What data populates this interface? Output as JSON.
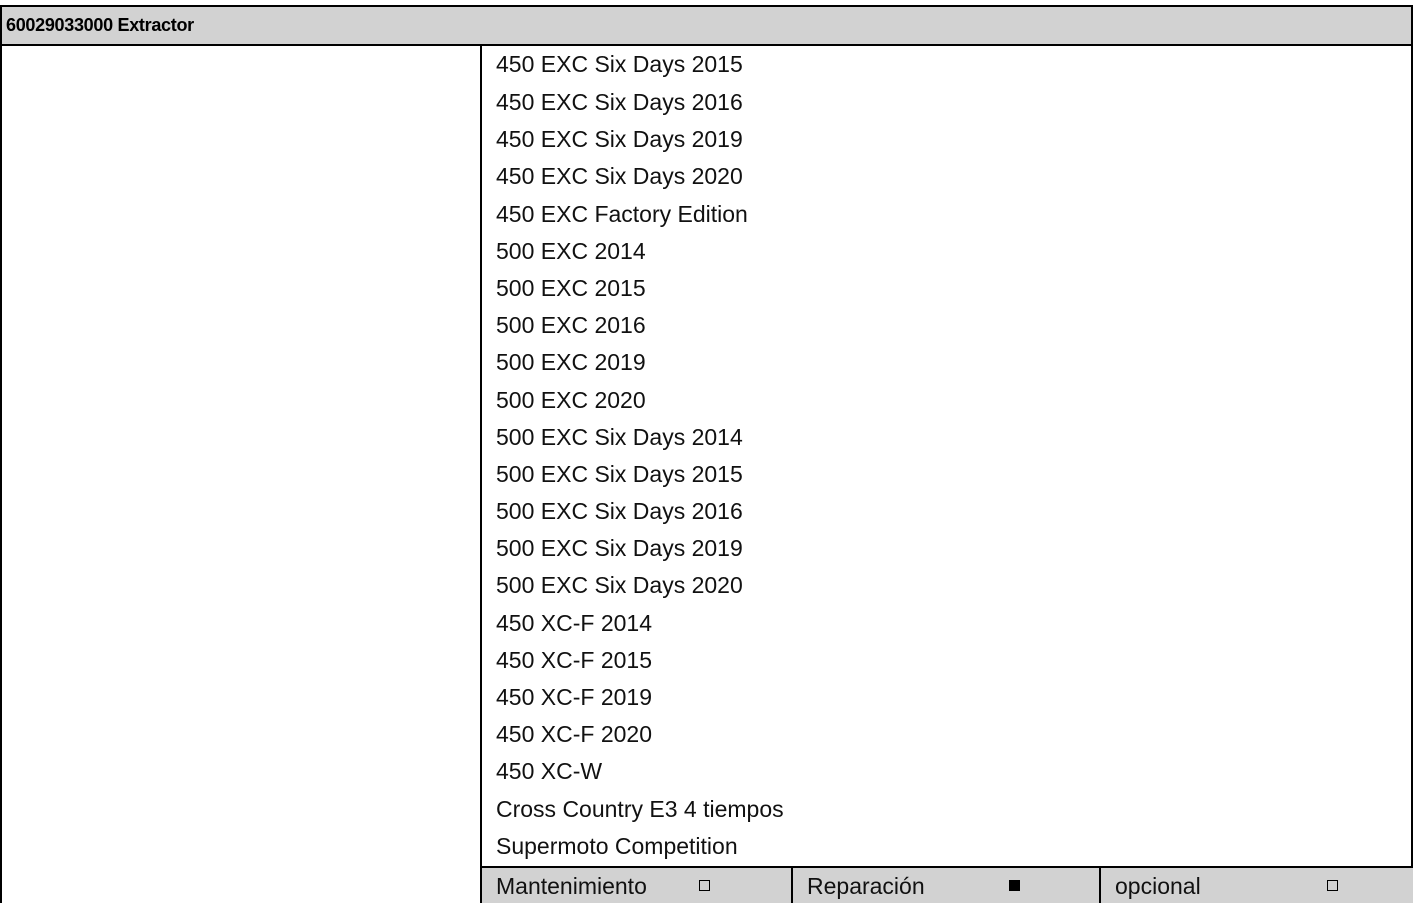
{
  "header": {
    "title": "60029033000 Extractor"
  },
  "models": [
    "450 EXC Six Days 2015",
    "450 EXC Six Days 2016",
    "450 EXC Six Days 2019",
    "450 EXC Six Days 2020",
    "450 EXC Factory Edition",
    "500 EXC 2014",
    "500 EXC 2015",
    "500 EXC 2016",
    "500 EXC 2019",
    "500 EXC 2020",
    "500 EXC Six Days 2014",
    "500 EXC Six Days 2015",
    "500 EXC Six Days 2016",
    "500 EXC Six Days 2019",
    "500 EXC Six Days 2020",
    "450 XC-F 2014",
    "450 XC-F 2015",
    "450 XC-F 2019",
    "450 XC-F 2020",
    "450 XC-W",
    "Cross Country E3 4 tiempos",
    "Supermoto Competition"
  ],
  "footer": {
    "maintenance": {
      "label": "Mantenimiento",
      "checked": false
    },
    "repair": {
      "label": "Reparación",
      "checked": true
    },
    "optional": {
      "label": "opcional",
      "checked": false
    }
  },
  "colors": {
    "header_background": "#d2d2d2",
    "footer_background": "#d2d2d2",
    "border": "#000000",
    "text": "#111111"
  }
}
